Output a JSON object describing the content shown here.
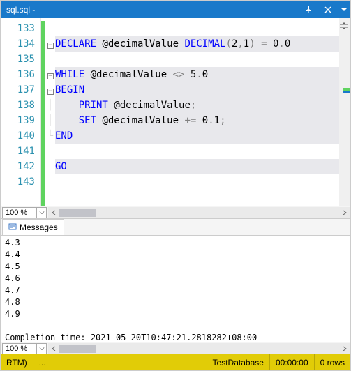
{
  "window": {
    "title": "sql.sql -"
  },
  "editor": {
    "zoom": "100 %",
    "line_numbers": [
      "133",
      "134",
      "135",
      "136",
      "137",
      "138",
      "139",
      "140",
      "141",
      "142",
      "143"
    ],
    "code_html": [
      "",
      "<span class='kw'>DECLARE</span> <span class='var'>@decimalValue</span> <span class='type'>DECIMAL</span><span class='op'>(</span>2<span class='op'>,</span>1<span class='op'>)</span> <span class='op'>=</span> 0<span class='op'>.</span>0",
      "",
      "<span class='kw'>WHILE</span> <span class='var'>@decimalValue</span> <span class='op'>&lt;&gt;</span> 5<span class='op'>.</span>0",
      "<span class='kw'>BEGIN</span>",
      "    <span class='kw'>PRINT</span> <span class='var'>@decimalValue</span><span class='op'>;</span>",
      "    <span class='kw'>SET</span> <span class='var'>@decimalValue</span> <span class='op'>+=</span> 0<span class='op'>.</span>1<span class='op'>;</span>",
      "<span class='kw'>END</span>",
      "",
      "<span class='kw'>GO</span>",
      ""
    ],
    "fold_markers": {
      "134": "box",
      "136": "box",
      "137": "box",
      "138": "line",
      "139": "line",
      "140": "end"
    }
  },
  "messages": {
    "tab_label": "Messages",
    "lines": [
      "4.3",
      "4.4",
      "4.5",
      "4.6",
      "4.7",
      "4.8",
      "4.9",
      "",
      "Completion time: 2021-05-20T10:47:21.2818282+08:00"
    ],
    "zoom": "100 %"
  },
  "status": {
    "conn": "RTM)",
    "ellipsis": "...",
    "db": "TestDatabase",
    "time": "00:00:00",
    "rows": "0 rows"
  }
}
